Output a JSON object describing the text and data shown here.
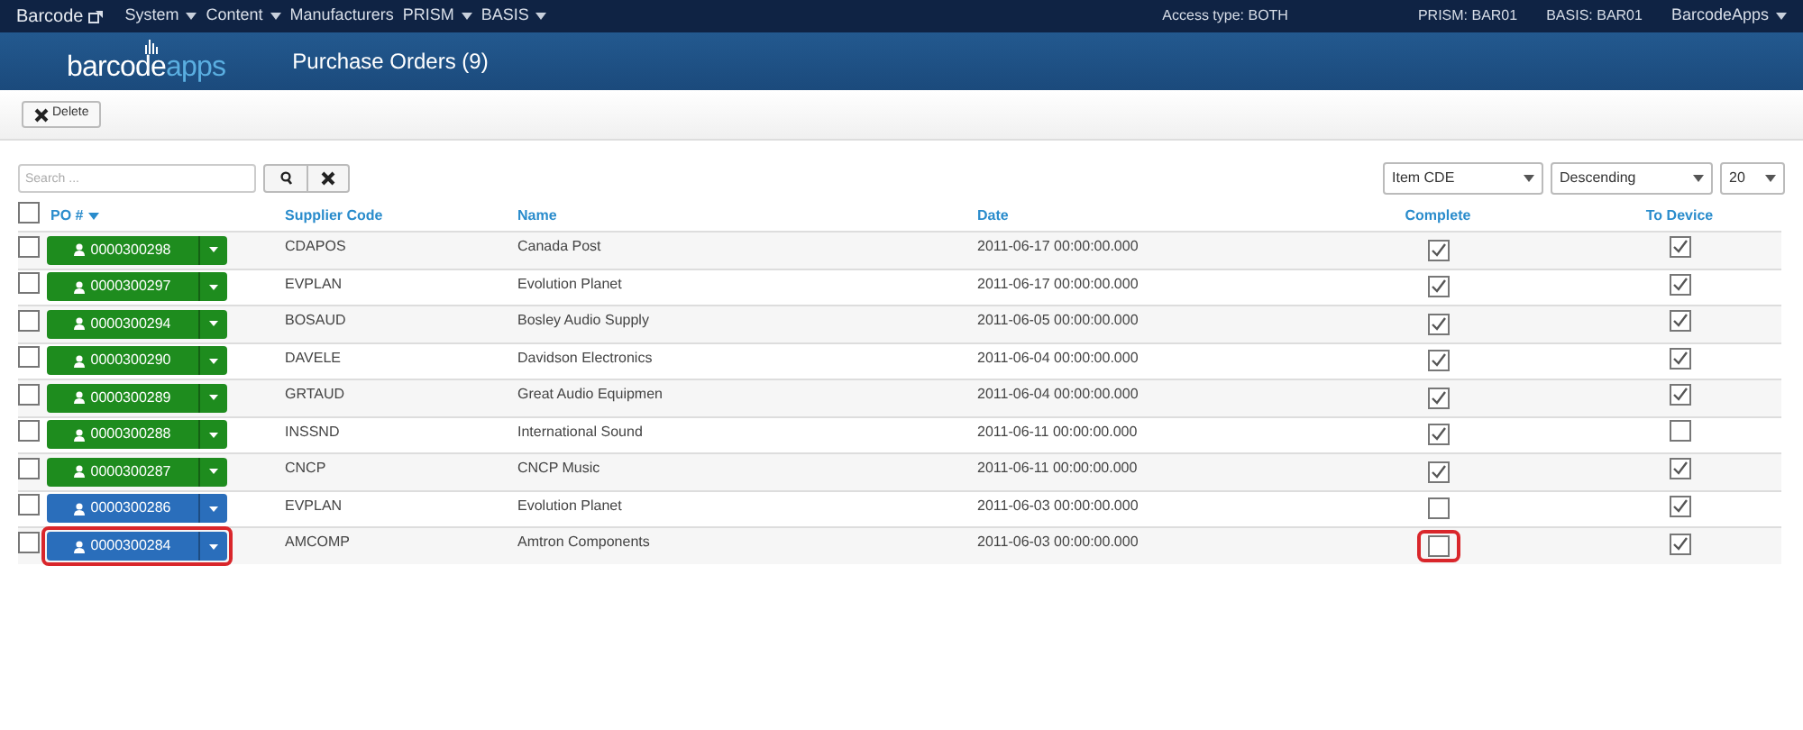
{
  "top_nav": {
    "brand": "Barcode",
    "menus": [
      {
        "label": "System",
        "dropdown": true
      },
      {
        "label": "Content",
        "dropdown": true
      },
      {
        "label": "Manufacturers",
        "dropdown": false
      },
      {
        "label": "PRISM",
        "dropdown": true
      },
      {
        "label": "BASIS",
        "dropdown": true
      }
    ],
    "right": [
      {
        "label": "Access type: BOTH",
        "dropdown": false
      },
      {
        "label": "PRISM: BAR01",
        "dropdown": false
      },
      {
        "label": "BASIS: BAR01",
        "dropdown": false
      },
      {
        "label": "BarcodeApps",
        "dropdown": true
      }
    ]
  },
  "header": {
    "logo_main": "barcode",
    "logo_accent": "apps",
    "title": "Purchase Orders (9)"
  },
  "toolbar": {
    "delete_label": "Delete"
  },
  "search": {
    "placeholder": "Search ..."
  },
  "sort": {
    "field": "Item CDE",
    "order": "Descending",
    "page_size": "20"
  },
  "table": {
    "select_all_checked": false,
    "columns": [
      "PO #",
      "Supplier Code",
      "Name",
      "Date",
      "Complete",
      "To Device"
    ],
    "rows": [
      {
        "checked": false,
        "po": "0000300298",
        "color": "#1e8c1e",
        "supplier": "CDAPOS",
        "name": "Canada Post",
        "date": "2011-06-17 00:00:00.000",
        "complete": true,
        "to_device": true,
        "highlighted": false
      },
      {
        "checked": false,
        "po": "0000300297",
        "color": "#1e8c1e",
        "supplier": "EVPLAN",
        "name": "Evolution Planet",
        "date": "2011-06-17 00:00:00.000",
        "complete": true,
        "to_device": true,
        "highlighted": false
      },
      {
        "checked": false,
        "po": "0000300294",
        "color": "#1e8c1e",
        "supplier": "BOSAUD",
        "name": "Bosley Audio Supply",
        "date": "2011-06-05 00:00:00.000",
        "complete": true,
        "to_device": true,
        "highlighted": false
      },
      {
        "checked": false,
        "po": "0000300290",
        "color": "#1e8c1e",
        "supplier": "DAVELE",
        "name": "Davidson Electronics",
        "date": "2011-06-04 00:00:00.000",
        "complete": true,
        "to_device": true,
        "highlighted": false
      },
      {
        "checked": false,
        "po": "0000300289",
        "color": "#1e8c1e",
        "supplier": "GRTAUD",
        "name": "Great Audio Equipmen",
        "date": "2011-06-04 00:00:00.000",
        "complete": true,
        "to_device": true,
        "highlighted": false
      },
      {
        "checked": false,
        "po": "0000300288",
        "color": "#1e8c1e",
        "supplier": "INSSND",
        "name": "International Sound",
        "date": "2011-06-11 00:00:00.000",
        "complete": true,
        "to_device": false,
        "highlighted": false
      },
      {
        "checked": false,
        "po": "0000300287",
        "color": "#1e8c1e",
        "supplier": "CNCP",
        "name": "CNCP Music",
        "date": "2011-06-11 00:00:00.000",
        "complete": true,
        "to_device": true,
        "highlighted": false
      },
      {
        "checked": false,
        "po": "0000300286",
        "color": "#2a6ebb",
        "supplier": "EVPLAN",
        "name": "Evolution Planet",
        "date": "2011-06-03 00:00:00.000",
        "complete": false,
        "to_device": true,
        "highlighted": false
      },
      {
        "checked": false,
        "po": "0000300284",
        "color": "#2a6ebb",
        "supplier": "AMCOMP",
        "name": "Amtron Components",
        "date": "2011-06-03 00:00:00.000",
        "complete": false,
        "to_device": true,
        "highlighted": true
      }
    ]
  }
}
